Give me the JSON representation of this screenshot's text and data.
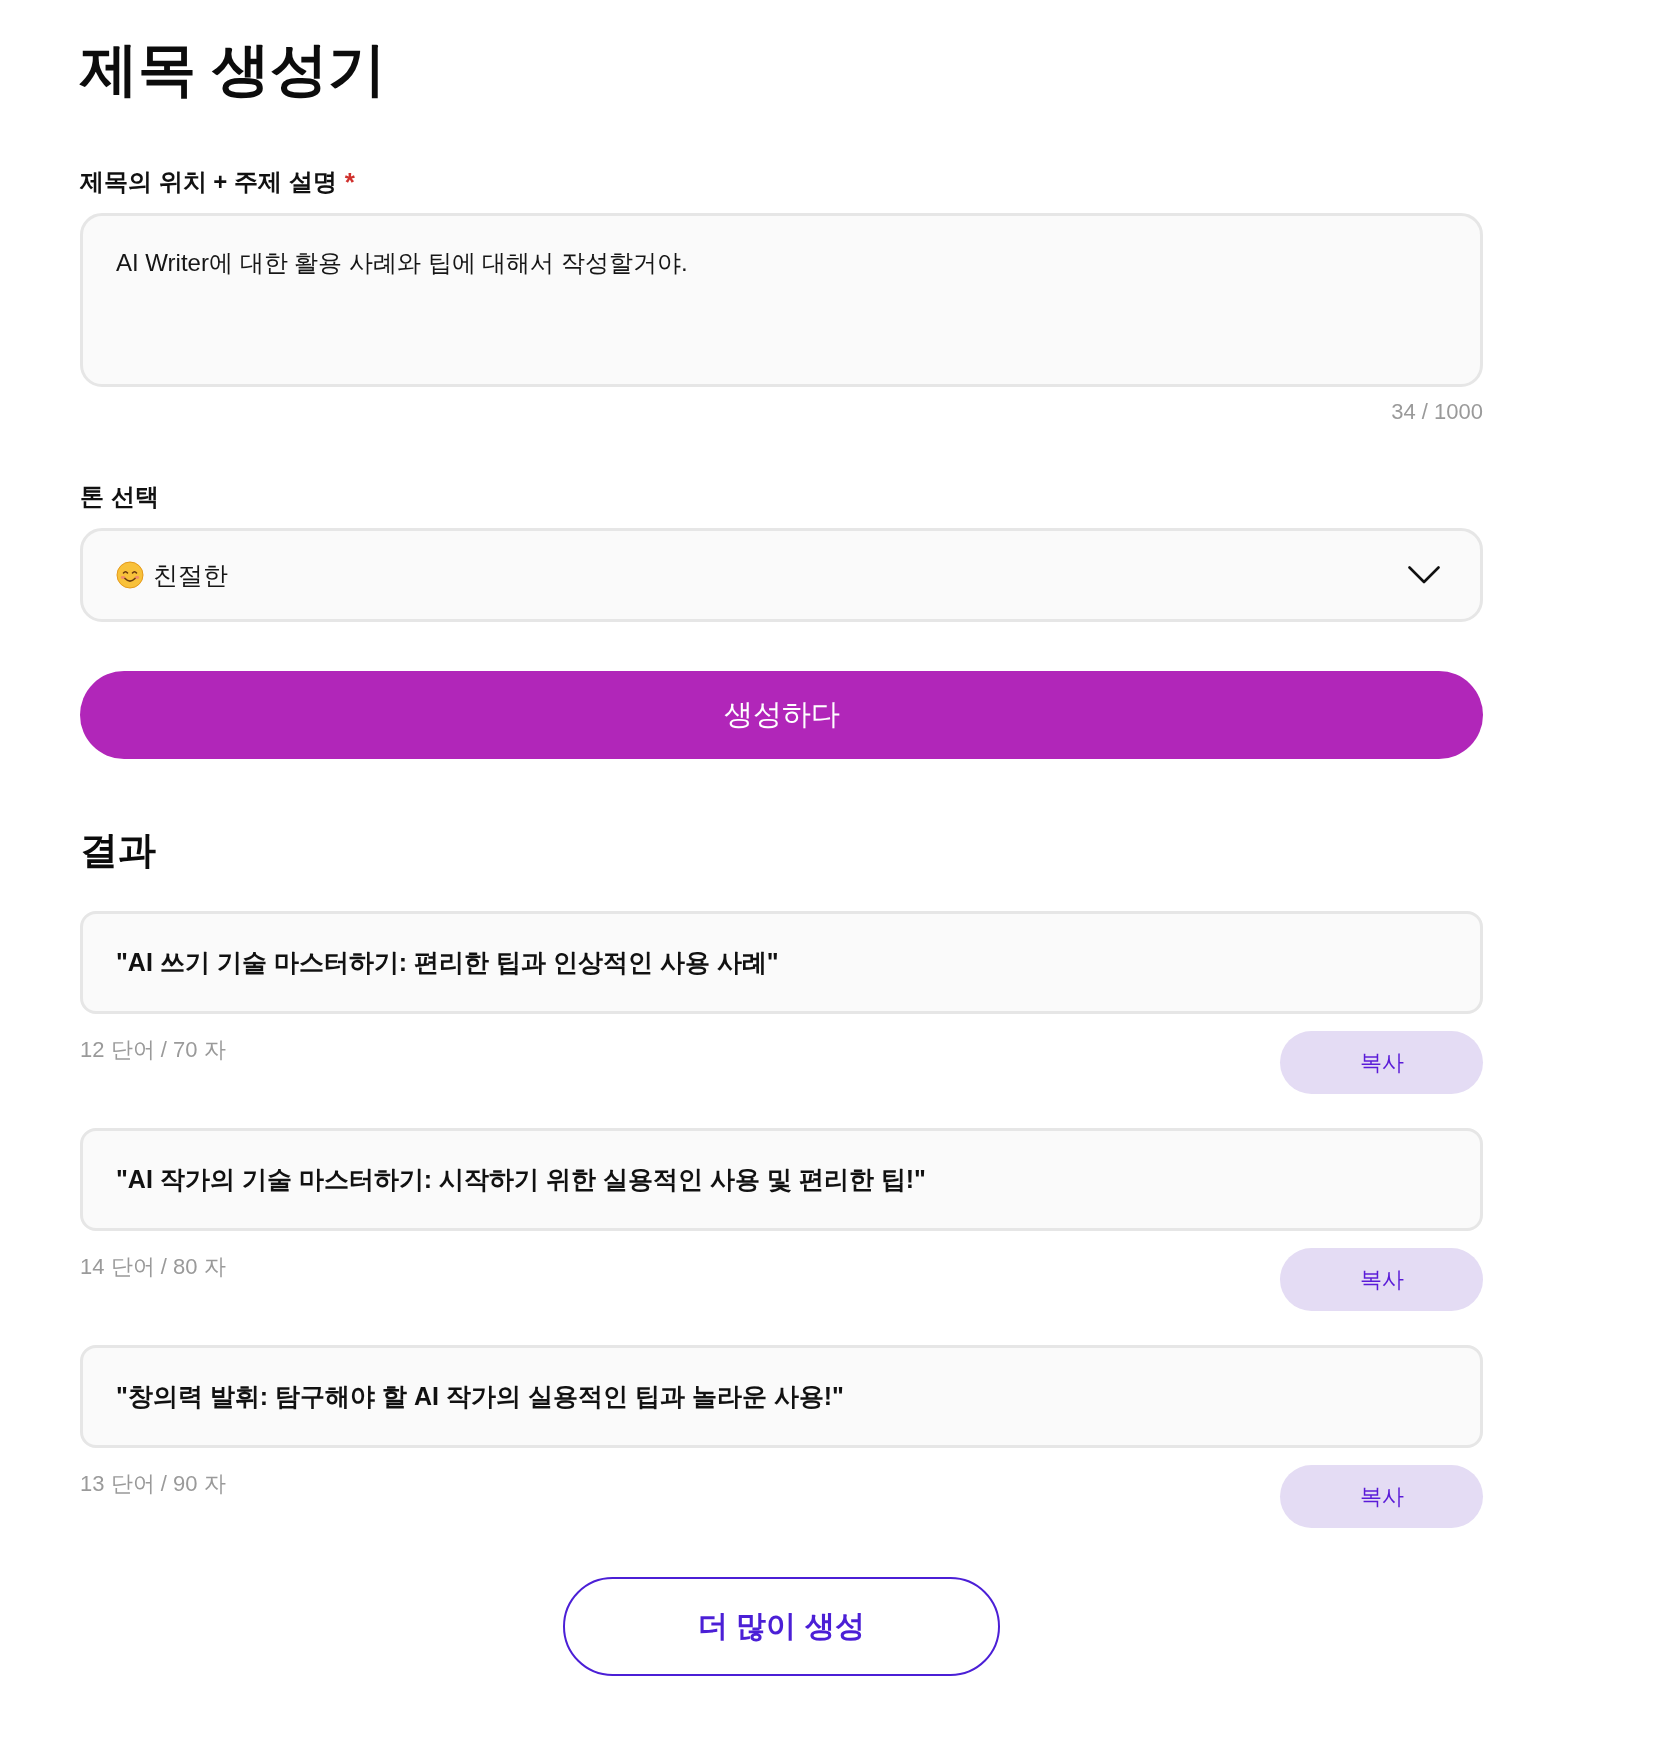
{
  "page": {
    "title": "제목 생성기"
  },
  "description_field": {
    "label": "제목의 위치 + 주제 설명",
    "required_mark": "*",
    "value": "AI Writer에 대한 활용 사례와 팁에 대해서 작성할거야.",
    "counter": "34 / 1000"
  },
  "tone_select": {
    "label": "톤 선택",
    "value": "친절한"
  },
  "generate_button": {
    "label": "생성하다"
  },
  "results": {
    "heading": "결과",
    "items": [
      {
        "text": "\"AI 쓰기 기술 마스터하기: 편리한 팁과 인상적인 사용 사례\"",
        "stats": "12 단어 / 70 자",
        "copy_label": "복사"
      },
      {
        "text": "\"AI 작가의 기술 마스터하기: 시작하기 위한 실용적인 사용 및 편리한 팁!\"",
        "stats": "14 단어 / 80 자",
        "copy_label": "복사"
      },
      {
        "text": "\"창의력 발휘: 탐구해야 할 AI 작가의 실용적인 팁과 놀라운 사용!\"",
        "stats": "13 단어 / 90 자",
        "copy_label": "복사"
      }
    ]
  },
  "more_button": {
    "label": "더 많이 생성"
  }
}
